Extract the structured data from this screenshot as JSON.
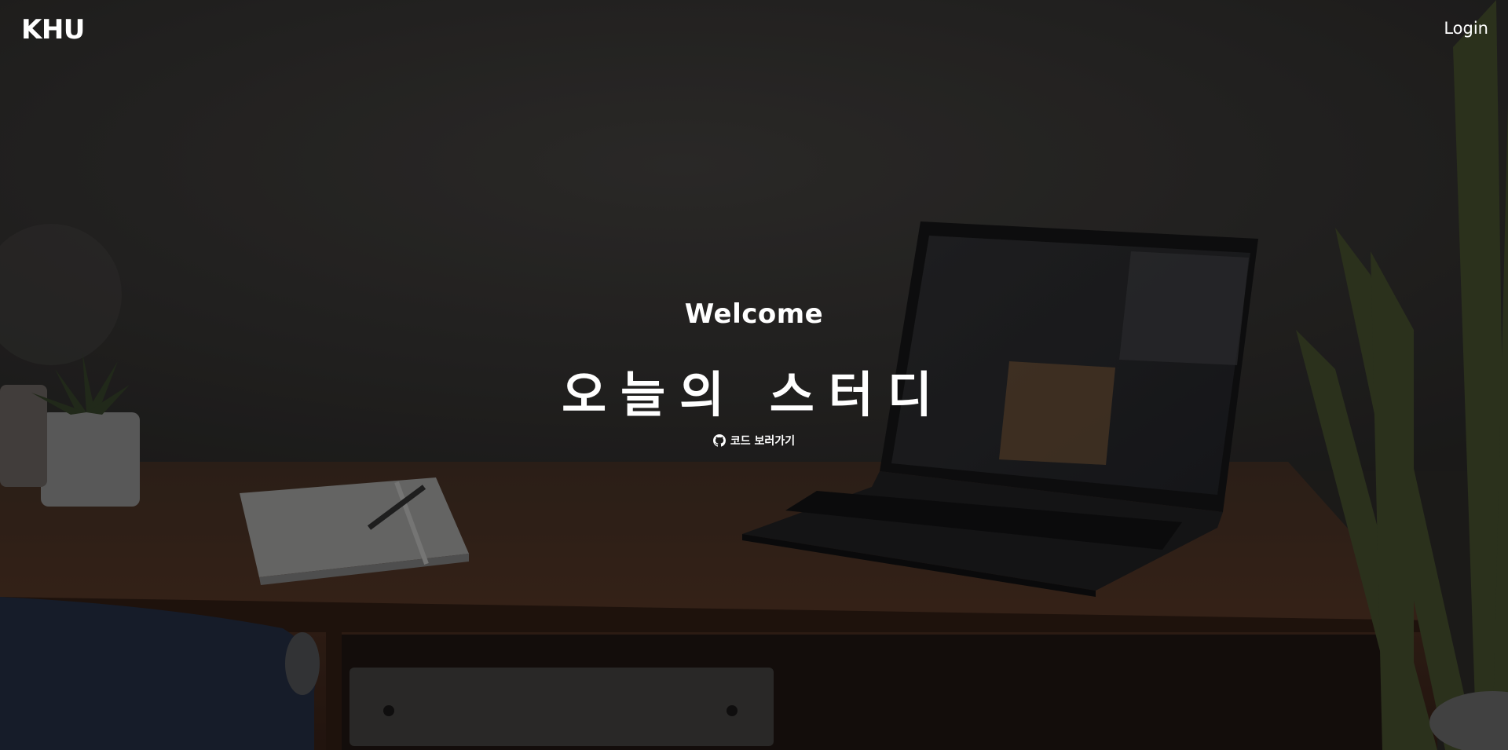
{
  "nav": {
    "brand": "KHU",
    "login_label": "Login"
  },
  "hero": {
    "welcome": "Welcome",
    "headline": "오늘의 스터디",
    "code_link": {
      "icon": "github-icon",
      "label": "코드 보러가기"
    }
  },
  "colors": {
    "text": "#ffffff",
    "wall": "#353331",
    "desk": "#3a241a"
  }
}
